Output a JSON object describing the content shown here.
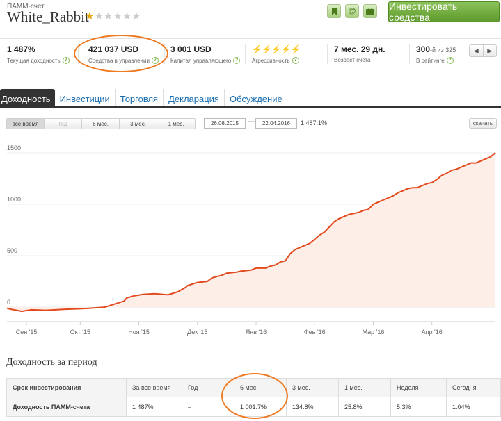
{
  "header": {
    "account_type": "ПАММ-счет",
    "account_name": "White_Rabbit",
    "rating_stars": 1,
    "rating_max": 5,
    "icons": [
      "bookmark-icon",
      "at-icon",
      "briefcase-icon"
    ],
    "invest_button": "Инвестировать средства"
  },
  "stats": [
    {
      "value": "1 487%",
      "label": "Текущая доходность"
    },
    {
      "value": "421 037 USD",
      "label": "Средства в управлении"
    },
    {
      "value": "3 001 USD",
      "label": "Капитал управляющего"
    },
    {
      "value": "⚡⚡⚡⚡⚡",
      "label": "Агрессивность"
    },
    {
      "value": "7 мес. 29 дн.",
      "label": "Возраст счета"
    },
    {
      "value": "300",
      "value_suffix": "-й из 325",
      "label": "В рейтинге"
    }
  ],
  "pager": {
    "prev": "◀",
    "next": "▶"
  },
  "tabs": [
    "Доходность",
    "Инвестиции",
    "Торговля",
    "Декларация",
    "Обсуждение"
  ],
  "active_tab": 0,
  "range_buttons": [
    "все время",
    "год",
    "6 мес.",
    "3 мес.",
    "1 мес."
  ],
  "active_range": 0,
  "date_from": "26.08.2015",
  "date_sep": "—",
  "date_to": "22.04.2016",
  "range_value": "1 487.1%",
  "download_button": "скачать",
  "chart_data": {
    "type": "area",
    "line_color": "#e24a1d",
    "fill_color": "#fdeee8",
    "y_ticks": [
      0,
      500,
      1000,
      1500
    ],
    "ylim": [
      -100,
      1600
    ],
    "x_tick_labels": [
      "Сен '15",
      "Окт '15",
      "Ноя '15",
      "Дек '15",
      "Янв '16",
      "Фев '16",
      "Мар '16",
      "Апр '16"
    ],
    "x_ticks_pos": [
      0.04,
      0.15,
      0.27,
      0.39,
      0.51,
      0.63,
      0.75,
      0.87
    ],
    "x": [
      0,
      0.008,
      0.02,
      0.03,
      0.05,
      0.08,
      0.1,
      0.12,
      0.15,
      0.17,
      0.2,
      0.22,
      0.24,
      0.245,
      0.26,
      0.28,
      0.3,
      0.305,
      0.33,
      0.35,
      0.365,
      0.37,
      0.39,
      0.41,
      0.42,
      0.44,
      0.45,
      0.47,
      0.48,
      0.5,
      0.51,
      0.53,
      0.54,
      0.55,
      0.56,
      0.57,
      0.58,
      0.59,
      0.6,
      0.61,
      0.62,
      0.63,
      0.64,
      0.65,
      0.66,
      0.67,
      0.68,
      0.69,
      0.7,
      0.71,
      0.72,
      0.73,
      0.74,
      0.75,
      0.76,
      0.77,
      0.78,
      0.79,
      0.8,
      0.81,
      0.82,
      0.83,
      0.84,
      0.85,
      0.86,
      0.87,
      0.88,
      0.89,
      0.9,
      0.91,
      0.92,
      0.93,
      0.94,
      0.95,
      0.96,
      0.97,
      0.98,
      0.99,
      1.0
    ],
    "values": [
      -10,
      -20,
      -30,
      -40,
      -25,
      -30,
      -25,
      -20,
      -15,
      -10,
      0,
      30,
      60,
      90,
      110,
      125,
      130,
      130,
      120,
      150,
      190,
      210,
      240,
      250,
      285,
      310,
      330,
      340,
      350,
      360,
      380,
      380,
      400,
      410,
      440,
      450,
      520,
      560,
      580,
      600,
      620,
      660,
      700,
      730,
      780,
      830,
      860,
      880,
      900,
      910,
      920,
      940,
      950,
      1000,
      1020,
      1040,
      1060,
      1080,
      1110,
      1130,
      1150,
      1160,
      1160,
      1180,
      1200,
      1210,
      1240,
      1280,
      1300,
      1330,
      1340,
      1360,
      1380,
      1400,
      1400,
      1420,
      1440,
      1460,
      1500
    ]
  },
  "period": {
    "title": "Доходность за период",
    "headers": [
      "Срок инвестирования",
      "За все время",
      "Год",
      "6 мес.",
      "3 мес.",
      "1 мес.",
      "Неделя",
      "Сегодня"
    ],
    "row": [
      "Доходность ПАММ-счета",
      "1 487%",
      "–",
      "1 001.7%",
      "134.8%",
      "25.8%",
      "5.3%",
      "1.04%"
    ]
  },
  "highlight_color": "#f07a21"
}
